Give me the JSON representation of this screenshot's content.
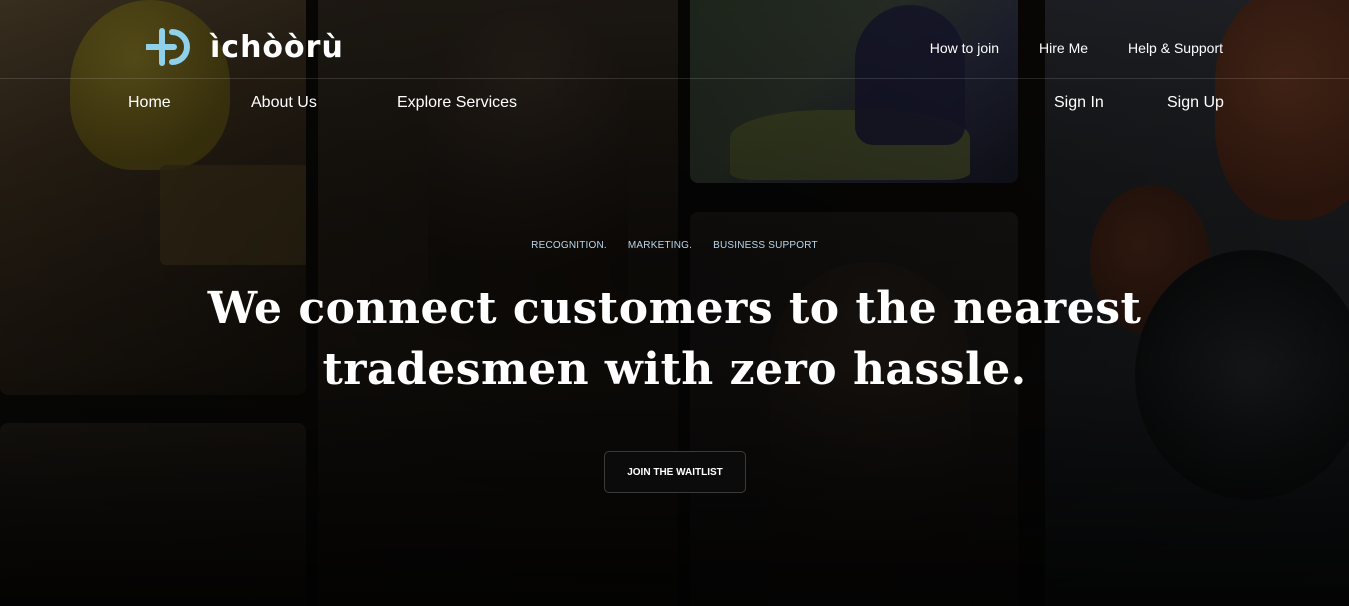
{
  "brand": {
    "name": "ìchòòrù",
    "logo_icon": "plus-circle-logo-icon",
    "accent": "#8fd0ea"
  },
  "top_links": [
    "How to join",
    "Hire Me",
    "Help & Support"
  ],
  "nav": {
    "home": "Home",
    "about": "About Us",
    "explore": "Explore Services",
    "sign_in": "Sign In",
    "sign_up": "Sign Up"
  },
  "hero": {
    "tags": [
      "RECOGNITION.",
      "MARKETING.",
      "BUSINESS SUPPORT"
    ],
    "headline_line1": "We connect customers to the nearest",
    "headline_line2": "tradesmen with zero hassle.",
    "cta_label": "JOIN THE WAITLIST"
  }
}
